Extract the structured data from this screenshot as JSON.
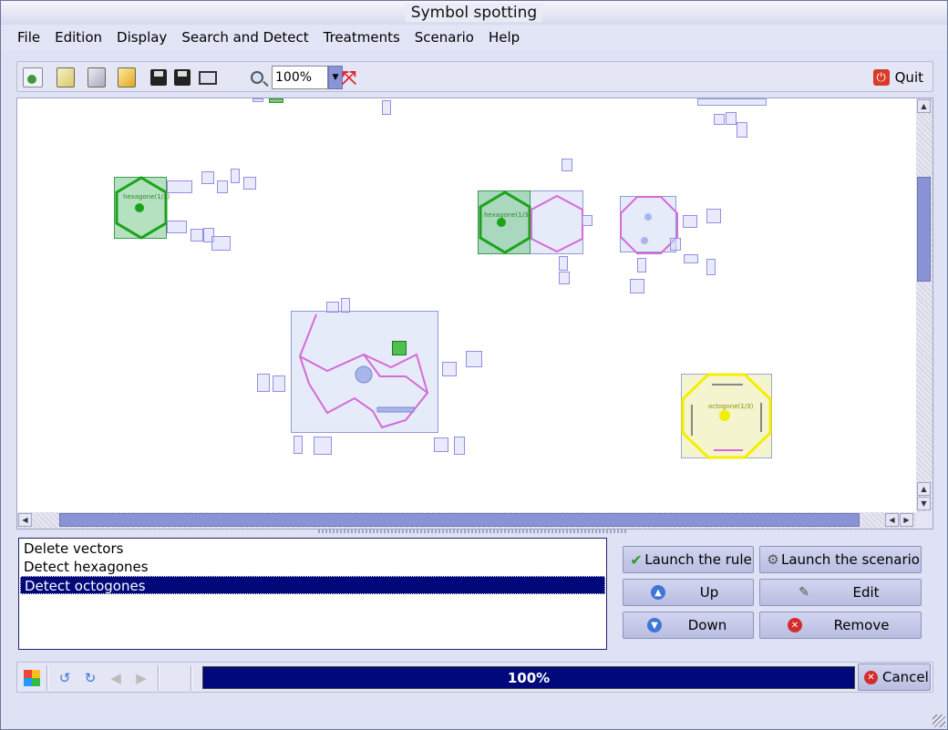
{
  "window": {
    "title": "Symbol spotting"
  },
  "menu": [
    "File",
    "Edition",
    "Display",
    "Search and Detect",
    "Treatments",
    "Scenario",
    "Help"
  ],
  "toolbar": {
    "zoom_value": "100%",
    "quit_label": "Quit"
  },
  "canvas": {
    "labels": {
      "hexagon_1": "hexagone(1/3)",
      "hexagon_2": "hexagone(1/3)",
      "octagon": "octogone(1/3)"
    },
    "colors": {
      "detected_hexagon": "#1aa31a",
      "detected_octagon": "#f2ef00",
      "segments": "#d66ad6",
      "boxes": "#8f9bd6"
    }
  },
  "rules": {
    "items": [
      "Delete vectors",
      "Detect hexagones",
      "Detect octogones"
    ],
    "selected_index": 2
  },
  "buttons": {
    "launch_rule": "Launch the rule",
    "launch_scenario": "Launch the scenario",
    "up": "Up",
    "edit": "Edit",
    "down": "Down",
    "remove": "Remove"
  },
  "status": {
    "progress_label": "100%",
    "progress_fraction": 1.0,
    "cancel_label": "Cancel"
  }
}
